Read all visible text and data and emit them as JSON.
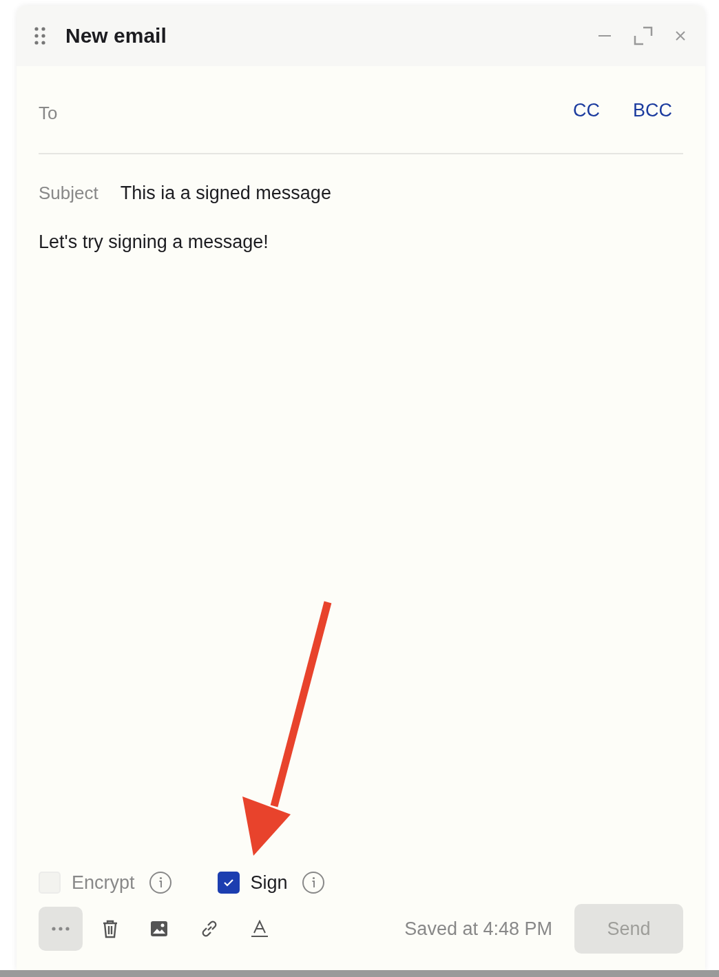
{
  "window": {
    "title": "New email"
  },
  "recipients": {
    "label": "To",
    "links": [
      "CC",
      "BCC"
    ]
  },
  "subject": {
    "label": "Subject",
    "value": "This ia a signed message"
  },
  "body": "Let's try signing a message!",
  "options": [
    {
      "label": "Encrypt",
      "checked": false,
      "disabled": true
    },
    {
      "label": "Sign",
      "checked": true,
      "disabled": false
    }
  ],
  "toolbar": {
    "status": "Saved at 4:48 PM",
    "send": {
      "label": "Send",
      "disabled": true
    }
  },
  "annotation": {
    "kind": "arrow"
  }
}
